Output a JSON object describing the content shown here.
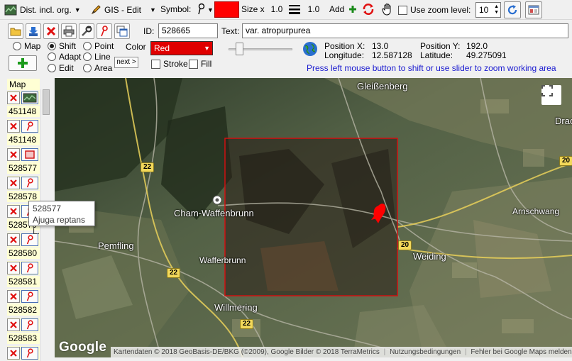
{
  "toolbar": {
    "mode_label": "Dist. incl. org.",
    "gis_label": "GIS - Edit",
    "symbol_label": "Symbol:",
    "size_label": "Size x",
    "size_value": "1.0",
    "line_value": "1.0",
    "add_label": "Add",
    "zoom_label": "Use zoom level:",
    "zoom_value": "10",
    "symbol_color": "#ff0000"
  },
  "form": {
    "id_label": "ID:",
    "id_value": "528665",
    "text_label": "Text:",
    "text_value": "var. atropurpurea",
    "color_label": "Color",
    "color_value": "Red",
    "radios": {
      "map": "Map",
      "shift": "Shift",
      "point": "Point",
      "adapt": "Adapt",
      "line": "Line",
      "edit": "Edit",
      "area": "Area"
    },
    "next_label": "next >",
    "stroke_label": "Stroke",
    "fill_label": "Fill",
    "position_x_label": "Position X:",
    "position_x_value": "13.0",
    "position_y_label": "Position Y:",
    "position_y_value": "192.0",
    "longitude_label": "Longitude:",
    "longitude_value": "12.587128",
    "latitude_label": "Latitude:",
    "latitude_value": "49.275091",
    "hint": "Press left mouse button to shift or use slider to zoom working area"
  },
  "list": {
    "header": "Map",
    "items": [
      {
        "id": "451148",
        "type": "map"
      },
      {
        "id": "451148",
        "type": "point"
      },
      {
        "id": "528577",
        "type": "area"
      },
      {
        "id": "528578",
        "type": "point"
      },
      {
        "id": "528579",
        "type": "point"
      },
      {
        "id": "528580",
        "type": "point"
      },
      {
        "id": "528581",
        "type": "point"
      },
      {
        "id": "528582",
        "type": "point"
      },
      {
        "id": "528583",
        "type": "point"
      },
      {
        "id": "",
        "type": "point"
      }
    ],
    "tooltip_id": "528577",
    "tooltip_name": "Ajuga reptans L."
  },
  "map": {
    "places": {
      "gleissenberg": "Gleißenberg",
      "drache": "Drache",
      "cham": "Cham-Waffenbrunn",
      "arnschwang": "Arnschwang",
      "pemfling": "Pemfling",
      "wafferbrunn": "Wafferbrunn",
      "weiding": "Weiding",
      "willmering": "Willmering"
    },
    "roads": {
      "r22a": "22",
      "r22b": "22",
      "r22c": "22",
      "r20a": "20",
      "r20b": "20"
    },
    "google_logo": "Google",
    "attribution": "Kartendaten © 2018 GeoBasis-DE/BKG (©2009), Google Bilder © 2018 TerraMetrics",
    "terms": "Nutzungsbedingungen",
    "report": "Fehler bei Google Maps melden",
    "rect_color": "#d01010",
    "marker_color": "#ff0000"
  }
}
